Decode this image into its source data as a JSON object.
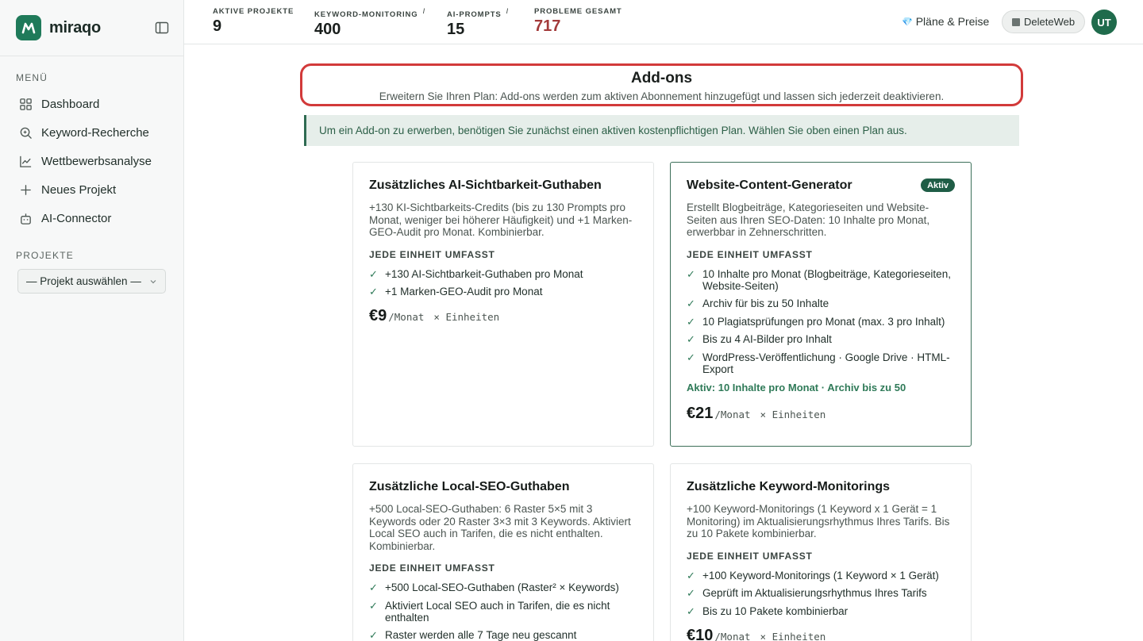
{
  "brand": {
    "name": "miraqo"
  },
  "sidebar": {
    "menu_label": "MENÜ",
    "items": [
      {
        "label": "Dashboard",
        "icon": "grid-icon"
      },
      {
        "label": "Keyword-Recherche",
        "icon": "search-icon"
      },
      {
        "label": "Wettbewerbsanalyse",
        "icon": "chart-icon"
      },
      {
        "label": "Neues Projekt",
        "icon": "plus-icon"
      },
      {
        "label": "AI-Connector",
        "icon": "robot-icon"
      }
    ],
    "projects_label": "PROJEKTE",
    "project_select": "— Projekt auswählen —"
  },
  "stats": [
    {
      "label": "AKTIVE PROJEKTE",
      "info": "",
      "value": "9"
    },
    {
      "label": "KEYWORD-MONITORING",
      "info": "i",
      "value": "400"
    },
    {
      "label": "AI-PROMPTS",
      "info": "i",
      "value": "15"
    },
    {
      "label": "PROBLEME GESAMT",
      "info": "",
      "value": "717"
    }
  ],
  "header": {
    "plans_label": "Pläne & Preise",
    "plans_icon": "💎",
    "workspace": "DeleteWeb",
    "avatar": "UT"
  },
  "addons": {
    "title": "Add-ons",
    "subtitle": "Erweitern Sie Ihren Plan: Add-ons werden zum aktiven Abonnement hinzugefügt und lassen sich jederzeit deaktivieren.",
    "notice": "Um ein Add-on zu erwerben, benötigen Sie zunächst einen aktiven kostenpflichtigen Plan. Wählen Sie oben einen Plan aus."
  },
  "cards": [
    {
      "title": "Zusätzliches AI-Sichtbarkeit-Guthaben",
      "desc": "+130 KI-Sichtbarkeits-Credits (bis zu 130 Prompts pro Monat, weniger bei höherer Häufigkeit) und +1 Marken-GEO-Audit pro Monat. Kombinierbar.",
      "sub": "JEDE EINHEIT UMFASST",
      "features": [
        "+130 AI-Sichtbarkeit-Guthaben pro Monat",
        "+1 Marken-GEO-Audit pro Monat"
      ],
      "price": "€9",
      "per": "/Monat",
      "units": "× Einheiten"
    },
    {
      "title": "Website-Content-Generator",
      "badge": "Aktiv",
      "desc": "Erstellt Blogbeiträge, Kategorieseiten und Website-Seiten aus Ihren SEO-Daten: 10 Inhalte pro Monat, erwerbbar in Zehnerschritten.",
      "sub": "JEDE EINHEIT UMFASST",
      "features": [
        "10 Inhalte pro Monat (Blogbeiträge, Kategorieseiten, Website-Seiten)",
        "Archiv für bis zu 50 Inhalte",
        "10 Plagiatsprüfungen pro Monat (max. 3 pro Inhalt)",
        "Bis zu 4 AI-Bilder pro Inhalt",
        "WordPress-Veröffentlichung · Google Drive · HTML-Export"
      ],
      "active_note": "Aktiv: 10 Inhalte pro Monat · Archiv bis zu 50",
      "price": "€21",
      "per": "/Monat",
      "units": "× Einheiten"
    },
    {
      "title": "Zusätzliche Local-SEO-Guthaben",
      "desc": "+500 Local-SEO-Guthaben: 6 Raster 5×5 mit 3 Keywords oder 20 Raster 3×3 mit 3 Keywords. Aktiviert Local SEO auch in Tarifen, die es nicht enthalten. Kombinierbar.",
      "sub": "JEDE EINHEIT UMFASST",
      "features": [
        "+500 Local-SEO-Guthaben (Raster² × Keywords)",
        "Aktiviert Local SEO auch in Tarifen, die es nicht enthalten",
        "Raster werden alle 7 Tage neu gescannt"
      ]
    },
    {
      "title": "Zusätzliche Keyword-Monitorings",
      "desc": "+100 Keyword-Monitorings (1 Keyword x 1 Gerät = 1 Monitoring) im Aktualisierungsrhythmus Ihres Tarifs. Bis zu 10 Pakete kombinierbar.",
      "sub": "JEDE EINHEIT UMFASST",
      "features": [
        "+100 Keyword-Monitorings (1 Keyword × 1 Gerät)",
        "Geprüft im Aktualisierungsrhythmus Ihres Tarifs",
        "Bis zu 10 Pakete kombinierbar"
      ],
      "price": "€10",
      "per": "/Monat",
      "units": "× Einheiten"
    }
  ]
}
